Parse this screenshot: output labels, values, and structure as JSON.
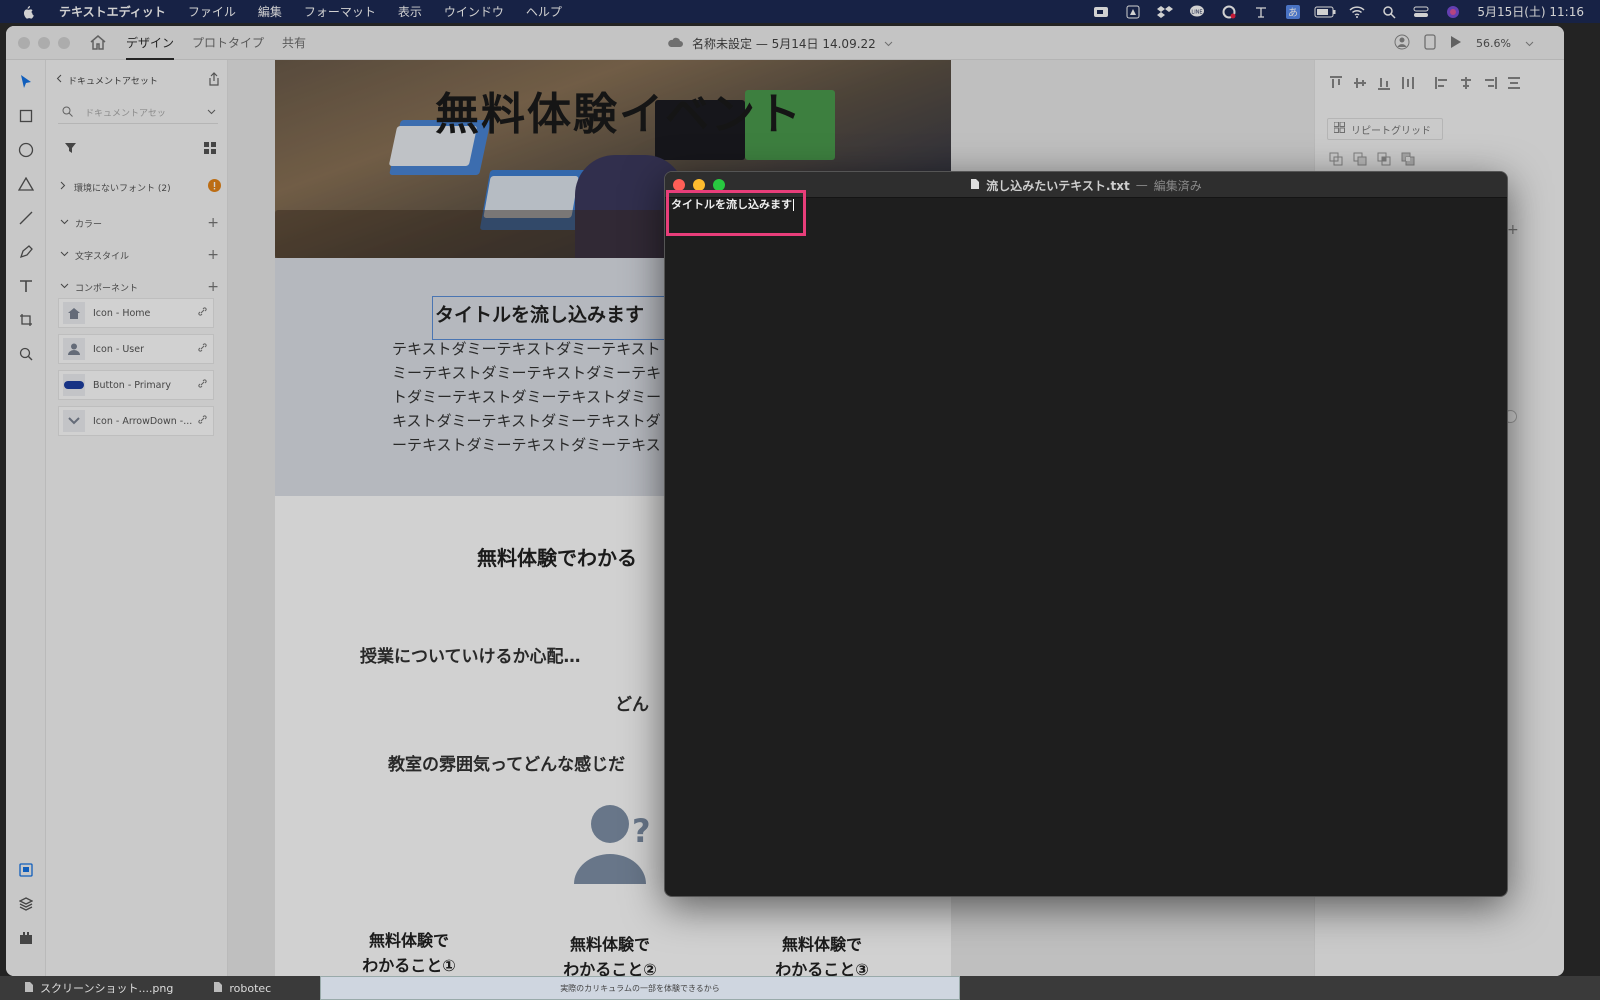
{
  "menubar": {
    "app_name": "テキストエディット",
    "items": [
      "ファイル",
      "編集",
      "フォーマット",
      "表示",
      "ウインドウ",
      "ヘルプ"
    ],
    "clock": "5月15日(土) 11:16"
  },
  "xd": {
    "tabs": [
      "デザイン",
      "プロトタイプ",
      "共有"
    ],
    "doc_title": "名称未設定 — 5月14日 14.09.22",
    "zoom": "56.6%",
    "assets": {
      "header": "ドキュメントアセット",
      "search_placeholder": "ドキュメントアセッ",
      "missing_fonts": "環境にないフォント (2)",
      "sections": [
        "カラー",
        "文字スタイル",
        "コンポーネント"
      ],
      "components": [
        "Icon - Home",
        "Icon - User",
        "Button - Primary",
        "Icon - ArrowDown -..."
      ]
    },
    "props": {
      "repeat_grid": "リピートグリッド"
    },
    "artboard": {
      "hero_title": "無料体験イベント",
      "intro_title": "タイトルを流し込みます",
      "dummy_lines": [
        "テキストダミーテキストダミーテキスト",
        "ミーテキストダミーテキストダミーテキ",
        "トダミーテキストダミーテキストダミー",
        "キストダミーテキストダミーテキストダ",
        "ーテキストダミーテキストダミーテキス"
      ],
      "section_heading": "無料体験でわかる",
      "q1": "授業についていけるか心配…",
      "q2": "どん",
      "q3": "教室の雰囲気ってどんな感じだ",
      "features": [
        "無料体験で\nわかること①",
        "無料体験で\nわかること②",
        "無料体験で\nわかること③"
      ]
    }
  },
  "textedit": {
    "filename": "流し込みたいテキスト.txt",
    "separator": "—",
    "status": "編集済み",
    "content": "タイトルを流し込みます"
  },
  "bottom": {
    "file1": "スクリーンショット....png",
    "file2": "robotec",
    "doc_text": "実際のカリキュラムの一部を体験できるから"
  },
  "colors": {
    "menubar_bg": "#1d2a55",
    "highlight": "#e83e7a",
    "selection": "#5b8fd9"
  }
}
